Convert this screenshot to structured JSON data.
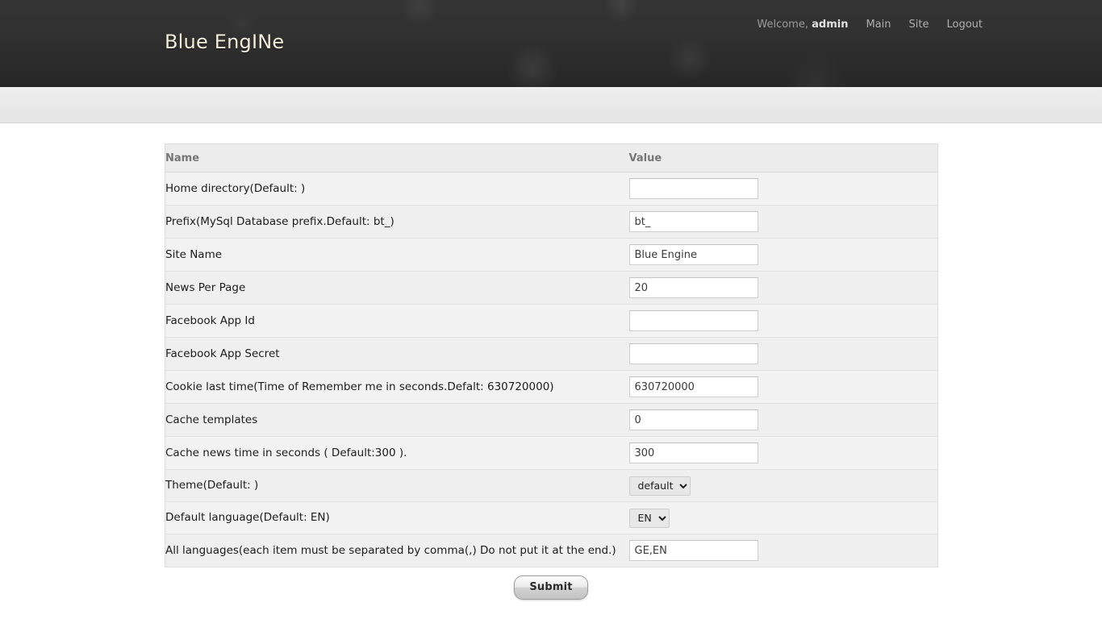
{
  "header": {
    "brand": "Blue EngINe",
    "welcome_prefix": "Welcome,",
    "username": "admin",
    "nav": [
      {
        "label": "Main"
      },
      {
        "label": "Site"
      },
      {
        "label": "Logout"
      }
    ]
  },
  "table": {
    "columns": [
      "Name",
      "Value"
    ],
    "rows": [
      {
        "name": "Home directory(Default: )",
        "type": "text",
        "value": "",
        "placeholder": ""
      },
      {
        "name": "Prefix(MySql Database prefix.Default: bt_)",
        "type": "text",
        "value": "bt_",
        "placeholder": ""
      },
      {
        "name": "Site Name",
        "type": "text",
        "value": "Blue Engine",
        "placeholder": ""
      },
      {
        "name": "News Per Page",
        "type": "text",
        "value": "20",
        "placeholder": ""
      },
      {
        "name": "Facebook App Id",
        "type": "text",
        "value": "",
        "placeholder": ""
      },
      {
        "name": "Facebook App Secret",
        "type": "text",
        "value": "",
        "placeholder": ""
      },
      {
        "name": "Cookie last time(Time of Remember me in seconds.Defalt: 630720000)",
        "type": "text",
        "value": "630720000",
        "placeholder": ""
      },
      {
        "name": "Cache templates",
        "type": "text",
        "value": "0",
        "placeholder": ""
      },
      {
        "name": "Cache news time in seconds ( Default:300 ).",
        "type": "text",
        "value": "300",
        "placeholder": ""
      },
      {
        "name": "Theme(Default: )",
        "type": "select",
        "value": "default",
        "options": [
          "default"
        ]
      },
      {
        "name": "Default language(Default: EN)",
        "type": "select",
        "value": "EN",
        "options": [
          "EN"
        ]
      },
      {
        "name": "All languages(each item must be separated by comma(,) Do not put it at the end.)",
        "type": "text",
        "value": "GE,EN",
        "placeholder": ""
      }
    ]
  },
  "form": {
    "submit_label": "Submit"
  },
  "colors": {
    "header_dark": "#313131",
    "brand_text": "#f3eeda",
    "nav_link": "#aeaeae",
    "sub_bar": "#e9e9e9",
    "table_header_bg": "#ececec",
    "table_header_text": "#767676",
    "row_bg_odd": "#f2f2f2",
    "row_bg_even": "#efefef",
    "input_border": "#cfcfcf"
  }
}
